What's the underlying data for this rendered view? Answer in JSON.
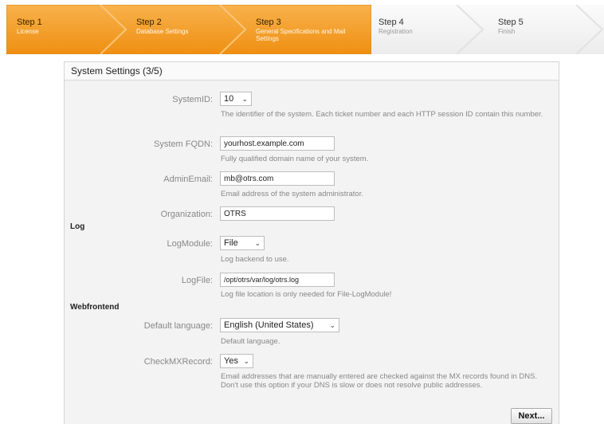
{
  "steps": [
    {
      "num": "Step 1",
      "sub": "License",
      "state": "done"
    },
    {
      "num": "Step 2",
      "sub": "Database Settings",
      "state": "done"
    },
    {
      "num": "Step 3",
      "sub": "General Specifications and Mail Settings",
      "state": "done"
    },
    {
      "num": "Step 4",
      "sub": "Registration",
      "state": "todo"
    },
    {
      "num": "Step 5",
      "sub": "Finish",
      "state": "todo"
    }
  ],
  "colors": {
    "active": "#f39a1f",
    "active_light": "#f7b44a",
    "inactive": "#f4f4f4"
  },
  "panel": {
    "title": "System Settings (3/5)"
  },
  "form": {
    "system_id": {
      "label": "SystemID:",
      "value": "10",
      "help": "The identifier of the system. Each ticket number and each HTTP session ID contain this number."
    },
    "fqdn": {
      "label": "System FQDN:",
      "value": "yourhost.example.com",
      "help": "Fully qualified domain name of your system."
    },
    "admin_email": {
      "label": "AdminEmail:",
      "value": "mb@otrs.com",
      "help": "Email address of the system administrator."
    },
    "organization": {
      "label": "Organization:",
      "value": "OTRS"
    },
    "log_section": "Log",
    "log_module": {
      "label": "LogModule:",
      "value": "File",
      "help": "Log backend to use."
    },
    "log_file": {
      "label": "LogFile:",
      "value": "/opt/otrs/var/log/otrs.log",
      "help": "Log file location is only needed for File-LogModule!"
    },
    "web_section": "Webfrontend",
    "default_language": {
      "label": "Default language:",
      "value": "English (United States)",
      "help": "Default language."
    },
    "check_mx": {
      "label": "CheckMXRecord:",
      "value": "Yes",
      "help": "Email addresses that are manually entered are checked against the MX records found in DNS. Don't use this option if your DNS is slow or does not resolve public addresses."
    }
  },
  "next_label": "Next..."
}
